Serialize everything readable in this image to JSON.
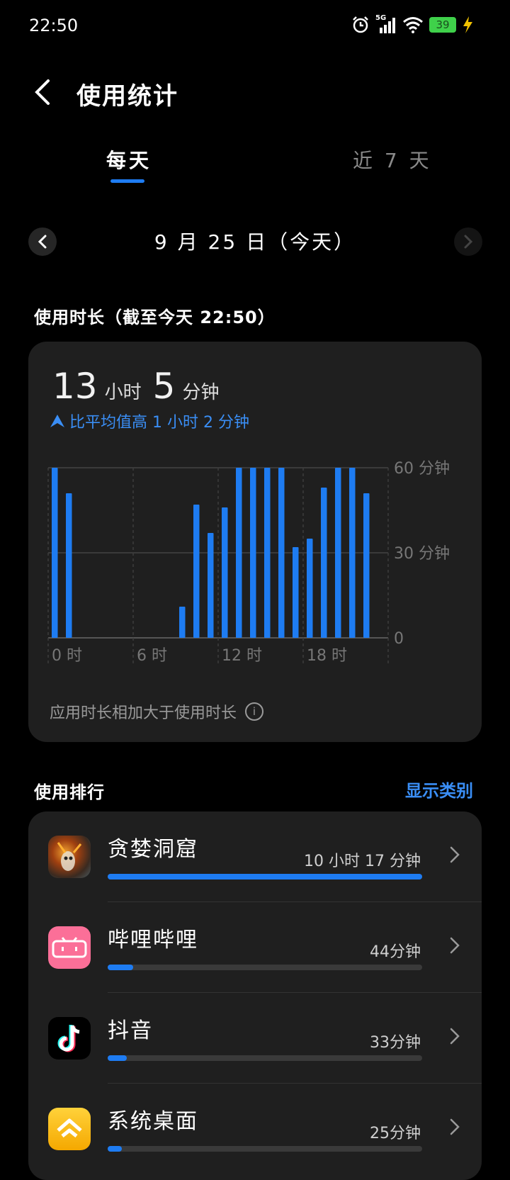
{
  "status": {
    "time": "22:50",
    "network": "5G",
    "battery": "39"
  },
  "header": {
    "title": "使用统计"
  },
  "tabs": [
    {
      "label": "每天"
    },
    {
      "label": "近 7 天"
    }
  ],
  "date": {
    "label": "9 月 25 日（今天）"
  },
  "usage": {
    "section_title": "使用时长（截至今天 22:50）",
    "total_hours": "13",
    "hours_unit": "小时",
    "total_minutes": "5",
    "minutes_unit": "分钟",
    "compare": "比平均值高 1 小时 2 分钟",
    "note": "应用时长相加大于使用时长"
  },
  "chart_data": {
    "type": "bar",
    "categories": [
      "0",
      "1",
      "2",
      "3",
      "4",
      "5",
      "6",
      "7",
      "8",
      "9",
      "10",
      "11",
      "12",
      "13",
      "14",
      "15",
      "16",
      "17",
      "18",
      "19",
      "20",
      "21",
      "22"
    ],
    "values": [
      60,
      51,
      0,
      0,
      0,
      0,
      0,
      0,
      0,
      11,
      47,
      37,
      46,
      60,
      60,
      60,
      60,
      32,
      35,
      53,
      60,
      60,
      51
    ],
    "x_tick_labels": [
      "0 时",
      "6 时",
      "12 时",
      "18 时"
    ],
    "y_tick_labels": [
      "60 分钟",
      "30 分钟",
      "0"
    ],
    "ylim": [
      0,
      60
    ],
    "color": "#1e7cf2"
  },
  "ranking": {
    "section_title": "使用排行",
    "show_categories": "显示类别",
    "apps": [
      {
        "name": "贪婪洞窟",
        "time": "10 小时 17 分钟",
        "fraction": 1.0,
        "icon": "greedy-cave-icon"
      },
      {
        "name": "哔哩哔哩",
        "time": "44分钟",
        "fraction": 0.08,
        "icon": "bilibili-icon"
      },
      {
        "name": "抖音",
        "time": "33分钟",
        "fraction": 0.06,
        "icon": "douyin-icon"
      },
      {
        "name": "系统桌面",
        "time": "25分钟",
        "fraction": 0.045,
        "icon": "home-launcher-icon"
      }
    ]
  }
}
